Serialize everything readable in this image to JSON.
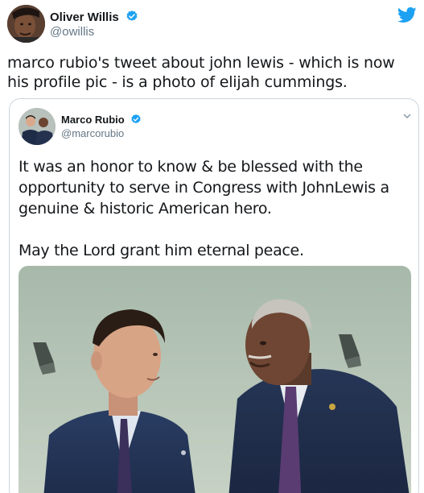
{
  "outer_tweet": {
    "author_name": "Oliver Willis",
    "author_handle": "@owillis",
    "text": "marco rubio's tweet about john lewis - which is now his profile pic - is a photo of elijah cummings."
  },
  "quoted_tweet": {
    "author_name": "Marco Rubio",
    "author_handle": "@marcorubio",
    "paragraphs": [
      "It was an honor to know & be blessed with the opportunity to serve in Congress with JohnLewis a genuine & historic American hero.",
      "May the Lord grant him eternal peace."
    ]
  },
  "colors": {
    "twitter_blue": "#1da1f2",
    "text_primary": "#14171a",
    "text_secondary": "#657786",
    "border": "#ccd6dd"
  },
  "icons": {
    "verified": "verified-badge-icon",
    "logo": "twitter-bird-icon",
    "menu": "chevron-down-icon"
  }
}
